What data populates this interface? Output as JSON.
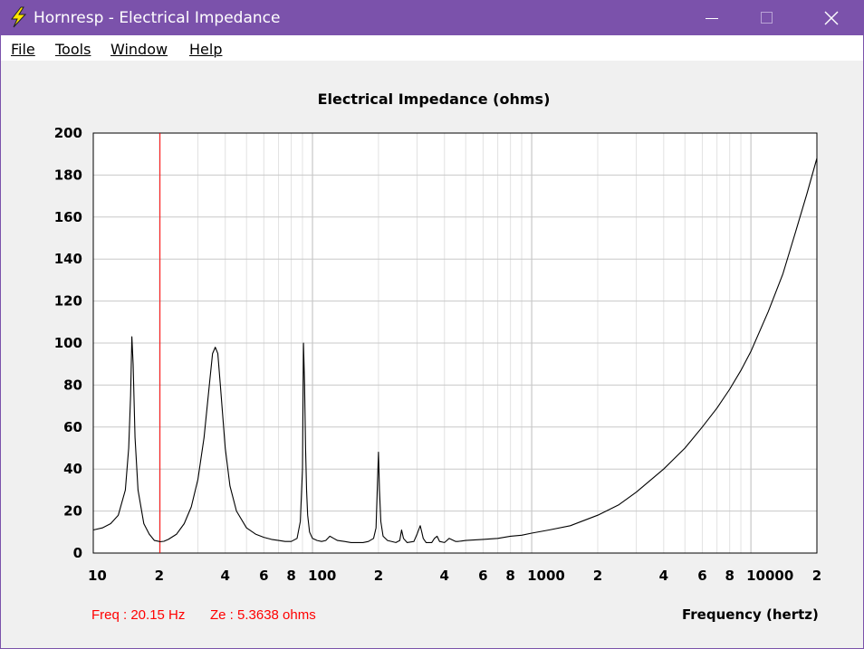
{
  "window": {
    "title": "Hornresp - Electrical Impedance",
    "icon": "lightning-icon",
    "controls": [
      "minimize-icon",
      "maximize-icon",
      "close-icon"
    ]
  },
  "menu": {
    "items": [
      {
        "label": "File"
      },
      {
        "label": "Tools"
      },
      {
        "label": "Window"
      },
      {
        "label": "Help"
      }
    ]
  },
  "status": {
    "freq": "Freq : 20.15 Hz",
    "ze": "Ze : 5.3638 ohms"
  },
  "colors": {
    "titlebar": "#7b52ab",
    "trace": "#000000",
    "cursor": "#ff0000",
    "grid_major": "#c8c8c8",
    "grid_minor": "#e2e2e2"
  },
  "chart_data": {
    "type": "line",
    "title": "Electrical Impedance (ohms)",
    "xlabel": "Frequency (hertz)",
    "ylabel": "",
    "x_scale": "log",
    "xlim": [
      10,
      20000
    ],
    "ylim": [
      0,
      200
    ],
    "grid": true,
    "y_ticks": [
      0,
      20,
      40,
      60,
      80,
      100,
      120,
      140,
      160,
      180,
      200
    ],
    "x_ticks": [
      {
        "value": 10,
        "label": "10"
      },
      {
        "value": 20,
        "label": "2"
      },
      {
        "value": 40,
        "label": "4"
      },
      {
        "value": 60,
        "label": "6"
      },
      {
        "value": 80,
        "label": "8"
      },
      {
        "value": 100,
        "label": "100"
      },
      {
        "value": 200,
        "label": "2"
      },
      {
        "value": 400,
        "label": "4"
      },
      {
        "value": 600,
        "label": "6"
      },
      {
        "value": 800,
        "label": "8"
      },
      {
        "value": 1000,
        "label": "1000"
      },
      {
        "value": 2000,
        "label": "2"
      },
      {
        "value": 4000,
        "label": "4"
      },
      {
        "value": 6000,
        "label": "6"
      },
      {
        "value": 8000,
        "label": "8"
      },
      {
        "value": 10000,
        "label": "10000"
      },
      {
        "value": 20000,
        "label": "2"
      }
    ],
    "cursor_x": 20.15,
    "series": [
      {
        "color": "#000000",
        "x": [
          10,
          11,
          12,
          13,
          14,
          14.5,
          14.8,
          15.0,
          15.2,
          15.5,
          16,
          17,
          18,
          19,
          20,
          20.15,
          21,
          22,
          24,
          26,
          28,
          30,
          32,
          34,
          35,
          36,
          37,
          38,
          40,
          42,
          45,
          50,
          55,
          60,
          65,
          70,
          75,
          80,
          85,
          88,
          90,
          91,
          92,
          93,
          94,
          95,
          97,
          100,
          105,
          110,
          115,
          120,
          125,
          130,
          140,
          150,
          160,
          170,
          180,
          190,
          195,
          198,
          200,
          202,
          205,
          210,
          220,
          240,
          250,
          255,
          260,
          270,
          290,
          300,
          310,
          315,
          320,
          330,
          350,
          360,
          370,
          380,
          400,
          410,
          420,
          440,
          450,
          460,
          500,
          600,
          700,
          800,
          900,
          1000,
          1200,
          1500,
          2000,
          2500,
          3000,
          4000,
          5000,
          6000,
          7000,
          8000,
          9000,
          10000,
          12000,
          14000,
          16000,
          18000,
          20000
        ],
        "y": [
          11,
          12,
          14,
          18,
          30,
          50,
          75,
          103,
          90,
          55,
          30,
          14,
          9,
          6,
          5.5,
          5.4,
          5.6,
          6.5,
          9,
          14,
          22,
          35,
          55,
          82,
          95,
          98,
          95,
          80,
          50,
          32,
          20,
          12,
          9,
          7.5,
          6.5,
          6,
          5.5,
          5.5,
          7,
          15,
          40,
          100,
          80,
          50,
          30,
          18,
          10,
          7,
          6,
          5.5,
          6,
          8,
          7,
          6,
          5.5,
          5,
          5,
          5,
          5.5,
          7,
          12,
          35,
          48,
          30,
          15,
          8,
          6,
          5,
          6,
          11,
          7,
          5,
          5.5,
          9,
          13,
          10,
          7,
          5,
          5,
          7,
          8,
          5.5,
          5,
          6,
          7,
          6,
          5.5,
          5.5,
          6,
          6.5,
          7,
          8,
          8.5,
          9.5,
          11,
          13,
          18,
          23,
          29,
          40,
          50,
          60,
          69,
          78,
          87,
          96,
          115,
          133,
          153,
          171,
          188
        ]
      }
    ]
  }
}
